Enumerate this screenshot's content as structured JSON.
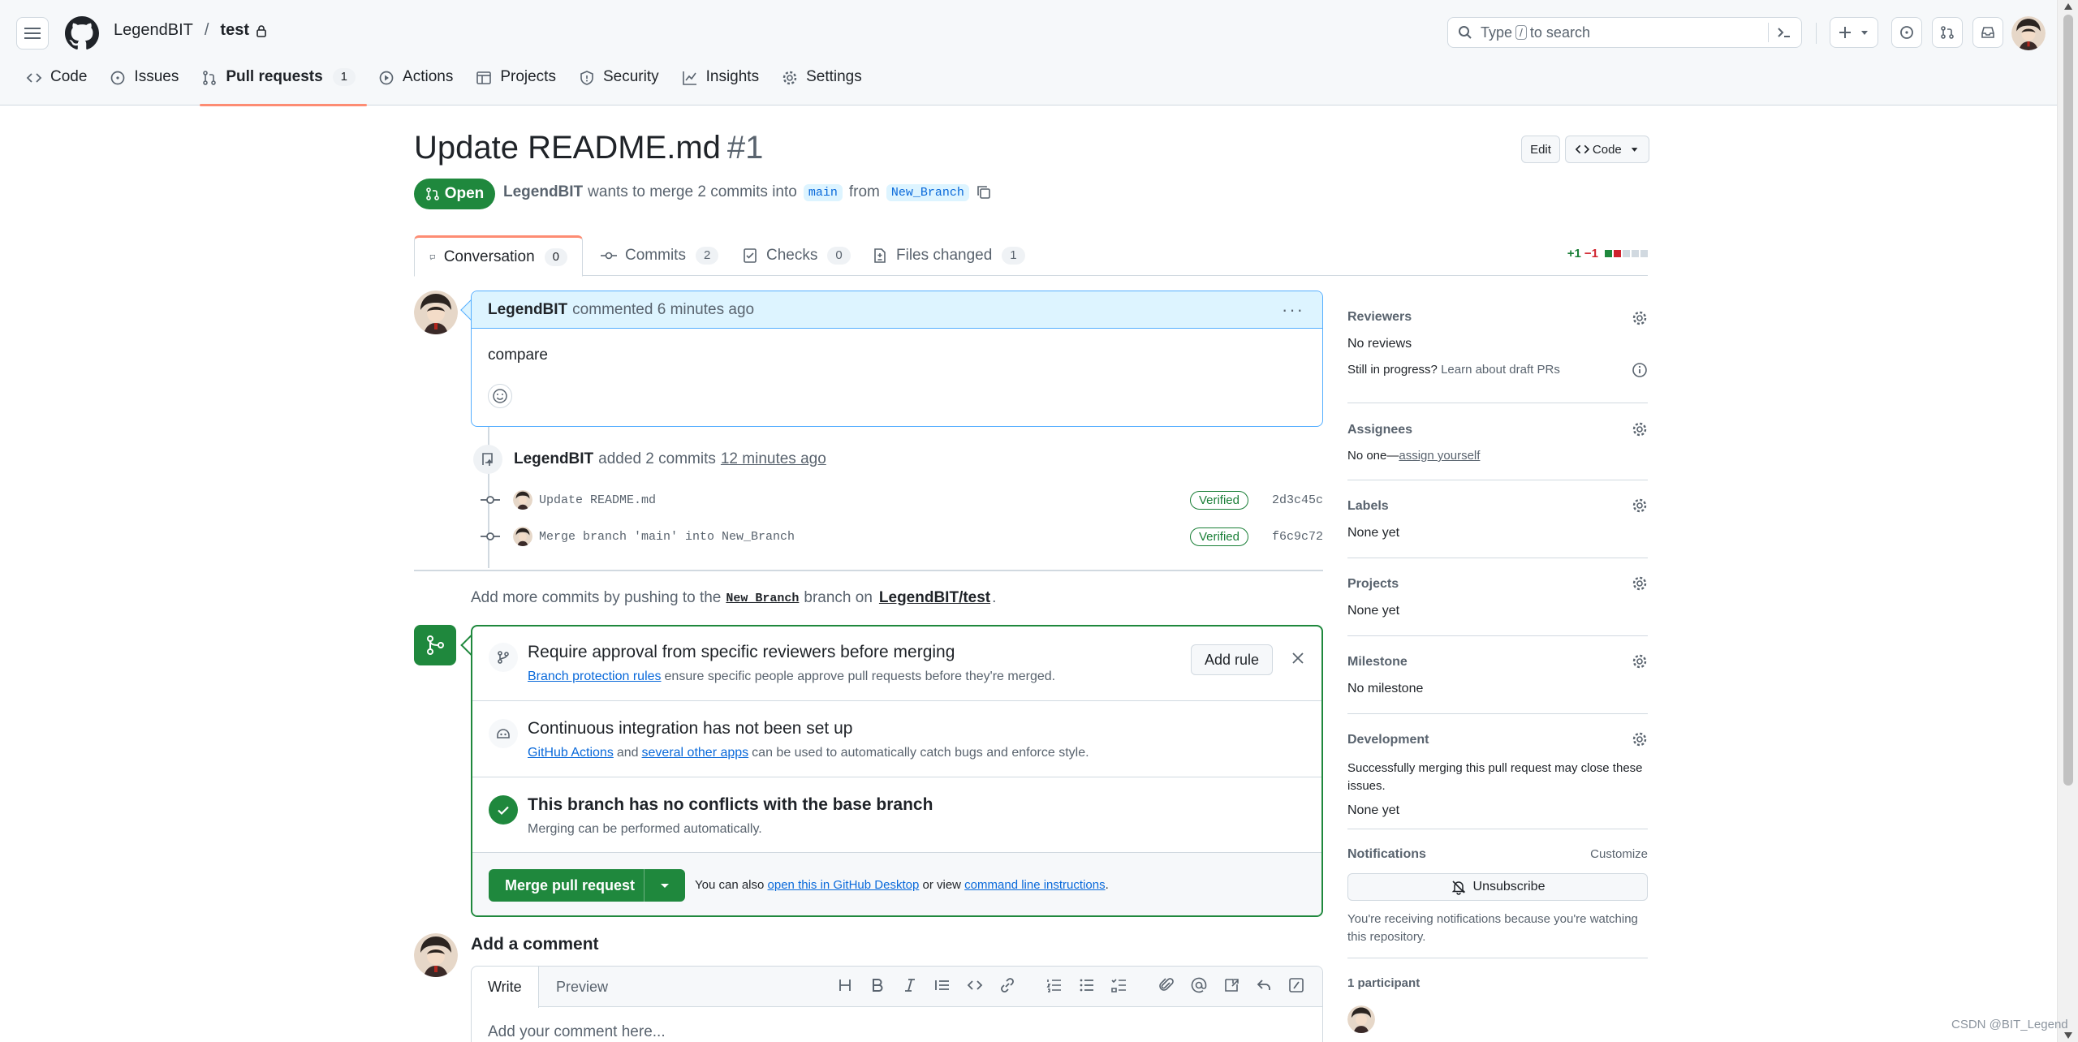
{
  "header": {
    "owner": "LegendBIT",
    "separator": "/",
    "repo": "test",
    "search_prefix": "Type",
    "search_key": "/",
    "search_suffix": "to search"
  },
  "repo_nav": [
    {
      "label": "Code",
      "icon": "code-icon"
    },
    {
      "label": "Issues",
      "icon": "issue-icon"
    },
    {
      "label": "Pull requests",
      "icon": "pull-request-icon",
      "count": "1",
      "selected": true
    },
    {
      "label": "Actions",
      "icon": "play-icon"
    },
    {
      "label": "Projects",
      "icon": "table-icon"
    },
    {
      "label": "Security",
      "icon": "shield-icon"
    },
    {
      "label": "Insights",
      "icon": "graph-icon"
    },
    {
      "label": "Settings",
      "icon": "gear-icon"
    }
  ],
  "pr": {
    "title": "Update README.md",
    "number": "#1",
    "edit_label": "Edit",
    "code_label": "Code",
    "state": "Open",
    "author": "LegendBIT",
    "wants_text": "wants to merge 2 commits into",
    "base": "main",
    "from_text": "from",
    "head": "New_Branch"
  },
  "tabs": [
    {
      "label": "Conversation",
      "count": "0"
    },
    {
      "label": "Commits",
      "count": "2"
    },
    {
      "label": "Checks",
      "count": "0"
    },
    {
      "label": "Files changed",
      "count": "1"
    }
  ],
  "diffstat": {
    "additions": "+1",
    "deletions": "−1"
  },
  "comment": {
    "author": "LegendBIT",
    "action": "commented 6 minutes ago",
    "menu": "···",
    "body": "compare"
  },
  "push_event": {
    "author": "LegendBIT",
    "text": "added 2 commits",
    "time": "12 minutes ago"
  },
  "commits": [
    {
      "message": "Update README.md",
      "badge": "Verified",
      "sha": "2d3c45c"
    },
    {
      "message": "Merge branch 'main' into New_Branch",
      "badge": "Verified",
      "sha": "f6c9c72"
    }
  ],
  "add_more": {
    "prefix": "Add more commits by pushing to the",
    "branch": "New_Branch",
    "middle": "branch on",
    "repo": "LegendBIT/test",
    "suffix": "."
  },
  "merge_box": {
    "approval_title": "Require approval from specific reviewers before merging",
    "approval_link": "Branch protection rules",
    "approval_text": "ensure specific people approve pull requests before they're merged.",
    "add_rule": "Add rule",
    "ci_title": "Continuous integration has not been set up",
    "ci_link1": "GitHub Actions",
    "ci_and": "and",
    "ci_link2": "several other apps",
    "ci_text": "can be used to automatically catch bugs and enforce style.",
    "conflict_title": "This branch has no conflicts with the base branch",
    "conflict_text": "Merging can be performed automatically.",
    "merge_button": "Merge pull request",
    "alt_prefix": "You can also",
    "alt_link1": "open this in GitHub Desktop",
    "alt_or": "or view",
    "alt_link2": "command line instructions",
    "alt_suffix": "."
  },
  "add_comment": {
    "title": "Add a comment",
    "write": "Write",
    "preview": "Preview",
    "placeholder": "Add your comment here..."
  },
  "sidebar": {
    "reviewers_title": "Reviewers",
    "reviewers_value": "No reviews",
    "draft_prefix": "Still in progress?",
    "draft_link": "Learn about draft PRs",
    "assignees_title": "Assignees",
    "assignees_prefix": "No one—",
    "assignees_link": "assign yourself",
    "labels_title": "Labels",
    "labels_value": "None yet",
    "projects_title": "Projects",
    "projects_value": "None yet",
    "milestone_title": "Milestone",
    "milestone_value": "No milestone",
    "development_title": "Development",
    "development_text": "Successfully merging this pull request may close these issues.",
    "development_value": "None yet",
    "notifications_title": "Notifications",
    "customize": "Customize",
    "unsubscribe": "Unsubscribe",
    "notif_text": "You're receiving notifications because you're watching this repository.",
    "participants": "1 participant"
  },
  "watermark": "CSDN @BIT_Legend",
  "colors": {
    "accent": "#1f883d",
    "link": "#0969da",
    "tab_underline": "#fd8c73"
  }
}
